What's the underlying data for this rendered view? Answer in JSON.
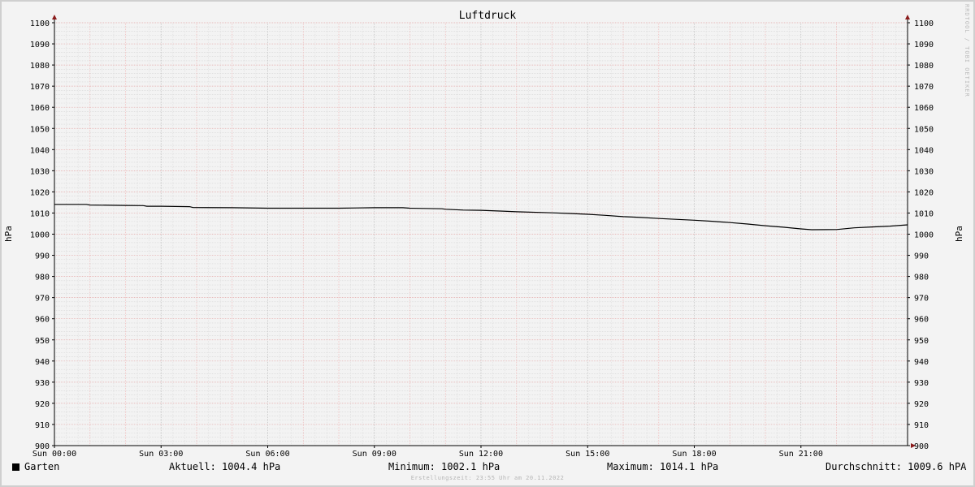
{
  "chart_data": {
    "type": "line",
    "title": "Luftdruck",
    "ylabel": "hPa",
    "ylim": [
      900,
      1100
    ],
    "yticks": [
      900,
      910,
      920,
      930,
      940,
      950,
      960,
      970,
      980,
      990,
      1000,
      1010,
      1020,
      1030,
      1040,
      1050,
      1060,
      1070,
      1080,
      1090,
      1100
    ],
    "xlim_hours": [
      0,
      24
    ],
    "xticks": [
      {
        "hour": 0,
        "label": "Sun 00:00"
      },
      {
        "hour": 3,
        "label": "Sun 03:00"
      },
      {
        "hour": 6,
        "label": "Sun 06:00"
      },
      {
        "hour": 9,
        "label": "Sun 09:00"
      },
      {
        "hour": 12,
        "label": "Sun 12:00"
      },
      {
        "hour": 15,
        "label": "Sun 15:00"
      },
      {
        "hour": 18,
        "label": "Sun 18:00"
      },
      {
        "hour": 21,
        "label": "Sun 21:00"
      }
    ],
    "grid": true,
    "series": [
      {
        "name": "Garten",
        "color": "#000000",
        "x": [
          0,
          0.9,
          1,
          2,
          2.5,
          2.6,
          3,
          3.8,
          3.9,
          5,
          6,
          7,
          8,
          8.5,
          9,
          9.8,
          10,
          10.9,
          11,
          11.5,
          12,
          12.6,
          13,
          14,
          14.5,
          15,
          15.5,
          16,
          16.5,
          17,
          18,
          18.5,
          19,
          19.5,
          20,
          20.5,
          21,
          21.3,
          22,
          22.5,
          23,
          23.5,
          24
        ],
        "y": [
          1014.1,
          1014.1,
          1013.8,
          1013.6,
          1013.5,
          1013.2,
          1013.2,
          1013.0,
          1012.6,
          1012.5,
          1012.3,
          1012.3,
          1012.3,
          1012.4,
          1012.5,
          1012.5,
          1012.3,
          1012.0,
          1011.8,
          1011.4,
          1011.3,
          1010.9,
          1010.6,
          1010.1,
          1009.8,
          1009.4,
          1008.9,
          1008.3,
          1007.9,
          1007.4,
          1006.6,
          1006.1,
          1005.5,
          1004.8,
          1004.0,
          1003.3,
          1002.5,
          1002.1,
          1002.2,
          1003.0,
          1003.4,
          1003.8,
          1004.4
        ]
      }
    ]
  },
  "legend": {
    "series_name": "Garten",
    "current": "Aktuell: 1004.4 hPa",
    "minimum": "Minimum: 1002.1 hPa",
    "maximum": "Maximum: 1014.1 hPa",
    "average": "Durchschnitt: 1009.6 hPA"
  },
  "watermark": "RRDTOOL / TOBI OETIKER",
  "footer": "Erstellungszeit: 23:55 Uhr am 20.11.2022"
}
